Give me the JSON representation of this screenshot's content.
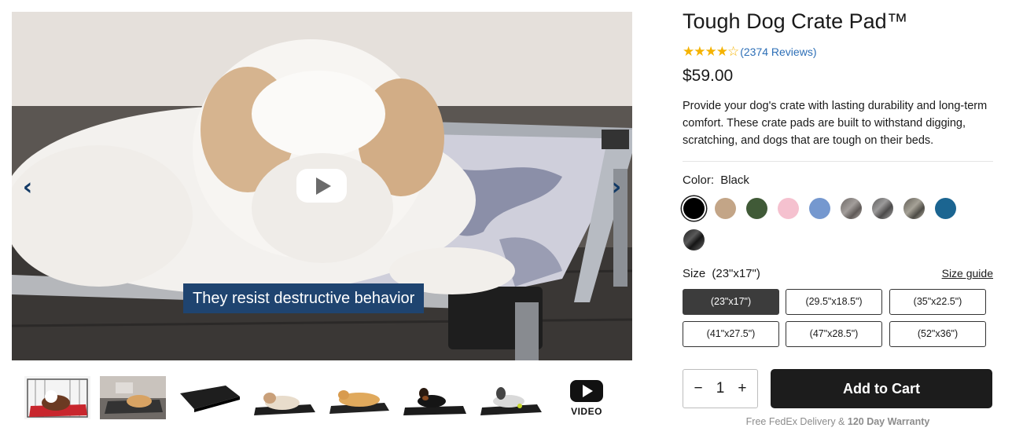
{
  "hero": {
    "caption": "They resist destructive behavior",
    "prev_arrow": "‹",
    "next_arrow": "›"
  },
  "thumbnails": {
    "video_label": "VIDEO",
    "items": [
      {
        "name": "thumb-dog-in-crate-red-pad"
      },
      {
        "name": "thumb-dog-on-elevated-bed"
      },
      {
        "name": "thumb-black-pad"
      },
      {
        "name": "thumb-bulldog-on-pad"
      },
      {
        "name": "thumb-golden-on-pad"
      },
      {
        "name": "thumb-rottweiler-on-pad"
      },
      {
        "name": "thumb-dalmatian-mix-on-pad"
      }
    ]
  },
  "product": {
    "title": "Tough Dog Crate Pad™",
    "rating": {
      "stars_filled": 4,
      "stars_total": 5,
      "reviews_text": "(2374 Reviews)"
    },
    "price": "$59.00",
    "description": "Provide your dog's crate with lasting durability and long-term comfort. These crate pads are built to withstand digging, scratching, and dogs that are tough on their beds.",
    "color": {
      "label": "Color:",
      "selected": "Black",
      "swatches": [
        {
          "name": "Black",
          "hex": "#000000"
        },
        {
          "name": "Tan",
          "hex": "#c3a587"
        },
        {
          "name": "Green",
          "hex": "#405a37"
        },
        {
          "name": "Pink",
          "hex": "#f5c1cf"
        },
        {
          "name": "Blue",
          "hex": "#7598cf"
        },
        {
          "name": "Gray camo",
          "hex": "#8a8583"
        },
        {
          "name": "Gray camo dark",
          "hex": "#7d7c7c"
        },
        {
          "name": "Olive camo",
          "hex": "#7e7b73"
        },
        {
          "name": "Teal",
          "hex": "#1b6591"
        },
        {
          "name": "Black camo",
          "hex": "#2c2c2c"
        }
      ]
    },
    "size": {
      "label": "Size",
      "selected": "(23\"x17\")",
      "guide_label": "Size guide",
      "options": [
        "(23\"x17\")",
        "(29.5\"x18.5\")",
        "(35\"x22.5\")",
        "(41\"x27.5\")",
        "(47\"x28.5\")",
        "(52\"x36\")"
      ]
    },
    "quantity": {
      "minus": "−",
      "value": "1",
      "plus": "+"
    },
    "add_to_cart": "Add to Cart",
    "delivery_prefix": "Free FedEx Delivery & ",
    "delivery_bold": "120 Day Warranty"
  },
  "colors": {
    "brand_blue": "#1f4470",
    "star": "#f5b301",
    "link": "#2d6fb7",
    "cart_button": "#1c1c1c"
  }
}
